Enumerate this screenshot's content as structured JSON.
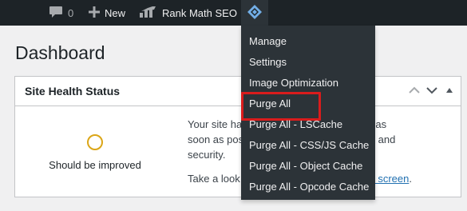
{
  "adminbar": {
    "comments_count": "0",
    "new_label": "New",
    "rank_math_label": "Rank Math SEO"
  },
  "page": {
    "title": "Dashboard"
  },
  "site_health": {
    "title": "Site Health Status",
    "status_label": "Should be improved",
    "description_visible": [
      "Your site ha",
      "e addressed as",
      "soon as pos",
      "nce and",
      "security."
    ],
    "cta_prefix": "Take a look",
    "cta_link": "alth screen",
    "cta_suffix": "."
  },
  "litespeed_menu": {
    "items": [
      "Manage",
      "Settings",
      "Image Optimization",
      "Purge All",
      "Purge All - LSCache",
      "Purge All - CSS/JS Cache",
      "Purge All - Object Cache",
      "Purge All - Opcode Cache"
    ],
    "highlighted": "Purge All"
  },
  "colors": {
    "adminbar_bg": "#1d2327",
    "submenu_bg": "#2c3338",
    "highlight_border": "#d91c1c",
    "health_warning": "#dba617",
    "link": "#2271b1"
  }
}
